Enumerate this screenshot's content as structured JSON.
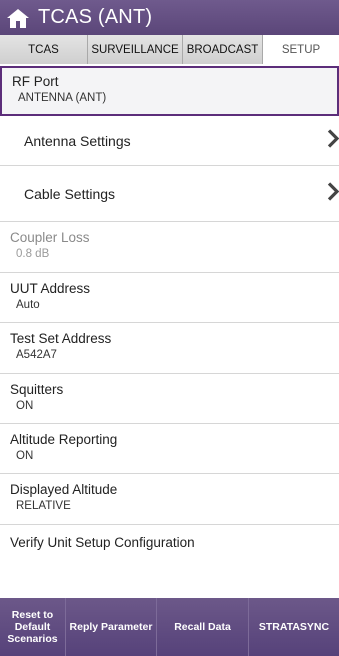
{
  "header": {
    "title": "TCAS (ANT)",
    "home_icon": "home-icon"
  },
  "tabs": [
    {
      "label": "TCAS",
      "active": false
    },
    {
      "label": "SURVEILLANCE",
      "active": false
    },
    {
      "label": "BROADCAST",
      "active": false
    },
    {
      "label": "SETUP",
      "active": true
    }
  ],
  "settings": {
    "rf_port": {
      "label": "RF Port",
      "value": "ANTENNA (ANT)"
    },
    "antenna_settings": {
      "label": "Antenna Settings"
    },
    "cable_settings": {
      "label": "Cable Settings"
    },
    "coupler_loss": {
      "label": "Coupler Loss",
      "value": "0.8 dB"
    },
    "uut_address": {
      "label": "UUT Address",
      "value": "Auto"
    },
    "test_set_address": {
      "label": "Test Set Address",
      "value": "A542A7"
    },
    "squitters": {
      "label": "Squitters",
      "value": "ON"
    },
    "altitude_reporting": {
      "label": "Altitude Reporting",
      "value": "ON"
    },
    "displayed_altitude": {
      "label": "Displayed Altitude",
      "value": "RELATIVE"
    },
    "verify_unit": {
      "label": "Verify Unit Setup Configuration"
    }
  },
  "footer": {
    "reset": "Reset to Default Scenarios",
    "reply": "Reply Parameter",
    "recall": "Recall Data",
    "stratasync": "STRATASYNC"
  },
  "colors": {
    "header": "#5b4679",
    "selected_border": "#5c2d7a",
    "footer": "#56427a"
  }
}
